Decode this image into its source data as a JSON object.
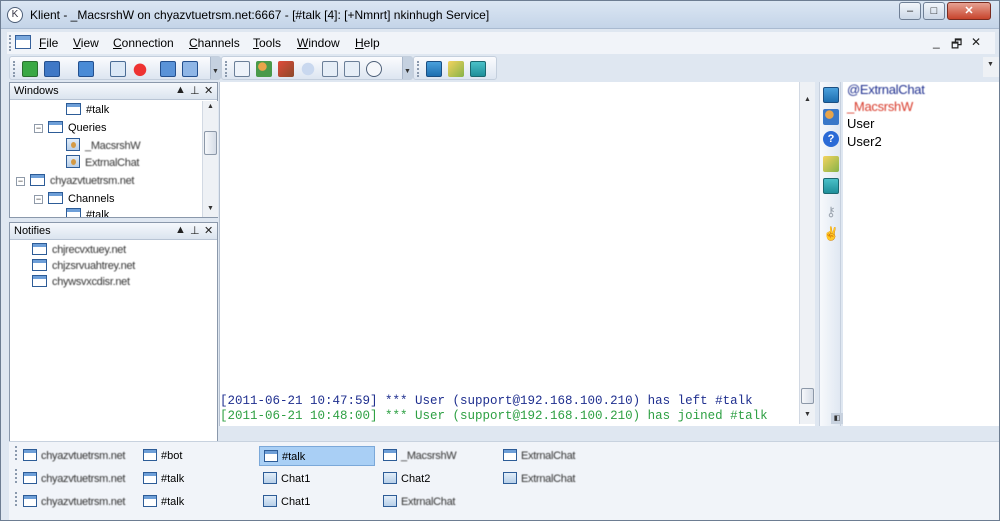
{
  "window": {
    "title": "Klient - _MacsrshW on chyazvtuetrsm.net:6667 - [#talk [4]: [+Nmnrt] nkinhugh Service]",
    "controls": {
      "minimize": "–",
      "maximize": "□",
      "close": "✕"
    },
    "colors": {
      "accent": "#1f3e8a",
      "join_green": "#2ea043",
      "op_blue": "#1f2f8f",
      "voice_red": "#d83a2a",
      "active_switch": "#a9cff5"
    }
  },
  "menubar": {
    "items": [
      {
        "label_u": "F",
        "label_rest": "ile"
      },
      {
        "label_u": "V",
        "label_rest": "iew"
      },
      {
        "label_u": "C",
        "label_rest": "onnection"
      },
      {
        "label_u": "C",
        "label_rest": "hannels"
      },
      {
        "label_u": "T",
        "label_rest": "ools"
      },
      {
        "label_u": "W",
        "label_rest": "indow"
      },
      {
        "label_u": "H",
        "label_rest": "elp"
      }
    ],
    "mdi_controls": {
      "minimize": "_",
      "restore": "🗗",
      "close": "✕"
    }
  },
  "toolbar": {
    "icons": [
      "new-server-icon",
      "connect-icon",
      "disconnect-icon",
      "favorites-icon",
      "tile-icon",
      "cascade-icon",
      "options-icon",
      "users-icon",
      "book-icon",
      "chat-bubble-icon",
      "log-icon",
      "klient-icon",
      "window-a-icon",
      "folder-icon",
      "window-b-icon",
      "info-icon",
      "settings-icon",
      "music-icon",
      "hourglass-icon",
      "color-icon"
    ]
  },
  "windows_panel": {
    "title": "Windows",
    "items": [
      {
        "label": "#talk",
        "icon": "window",
        "level": 3
      },
      {
        "label": "Queries",
        "icon": "window",
        "level": 2
      },
      {
        "label": "_MacsrshW",
        "icon": "query",
        "level": 3
      },
      {
        "label": "ExtrnalChat",
        "icon": "query",
        "level": 3
      },
      {
        "label": "chyazvtuetrsm.net",
        "icon": "window",
        "level": 1
      },
      {
        "label": "Channels",
        "icon": "window",
        "level": 2
      },
      {
        "label": "#talk",
        "icon": "window",
        "level": 3
      }
    ]
  },
  "notifies_panel": {
    "title": "Notifies",
    "items": [
      {
        "label": "chjrecvxtuey.net"
      },
      {
        "label": "chjzsrvuahtrey.net"
      },
      {
        "label": "chywsvxcdisr.net"
      }
    ]
  },
  "chat": {
    "lines": [
      {
        "text": "[2011-06-21 10:47:59] *** User (support@192.168.100.210) has left #talk",
        "kind": "part"
      },
      {
        "text": "[2011-06-21 10:48:00] *** User (support@192.168.100.210) has joined #talk",
        "kind": "join"
      }
    ]
  },
  "nicklist": {
    "nicks": [
      {
        "label": "@ExtrnalChat",
        "kind": "op"
      },
      {
        "label": "_MacsrshW",
        "kind": "voice"
      },
      {
        "label": "User",
        "kind": "normal"
      },
      {
        "label": "User2",
        "kind": "normal"
      }
    ]
  },
  "switchbar": {
    "rows": [
      [
        {
          "label": "chyazvtuetrsm.net",
          "icon": "window"
        },
        {
          "label": "#bot",
          "icon": "window"
        },
        {
          "label": "#talk",
          "icon": "window",
          "active": true
        },
        {
          "label": "_MacsrshW",
          "icon": "window"
        },
        {
          "label": "ExtrnalChat",
          "icon": "window"
        }
      ],
      [
        {
          "label": "chyazvtuetrsm.net",
          "icon": "window"
        },
        {
          "label": "#talk",
          "icon": "window"
        },
        {
          "label": "Chat1",
          "icon": "query"
        },
        {
          "label": "Chat2",
          "icon": "query"
        },
        {
          "label": "ExtrnalChat",
          "icon": "query"
        }
      ],
      [
        {
          "label": "chyazvtuetrsm.net",
          "icon": "window"
        },
        {
          "label": "#talk",
          "icon": "window"
        },
        {
          "label": "Chat1",
          "icon": "query"
        },
        {
          "label": "ExtrnalChat",
          "icon": "query"
        }
      ]
    ]
  }
}
